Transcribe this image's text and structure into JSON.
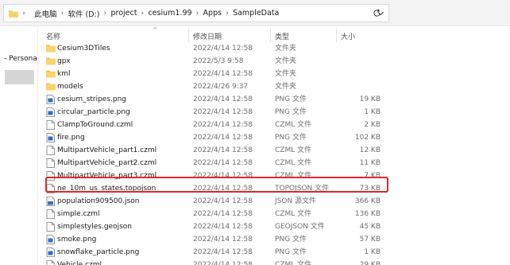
{
  "address": {
    "crumbs": [
      "此电脑",
      "软件 (D:)",
      "project",
      "cesium1.99",
      "Apps",
      "SampleData"
    ]
  },
  "left_pane": {
    "label": "- Persona"
  },
  "columns": {
    "name": "名称",
    "date": "修改日期",
    "type": "类型",
    "size": "大小"
  },
  "rows": [
    {
      "name": "Cesium3DTiles",
      "date": "2022/4/14 12:58",
      "type": "文件夹",
      "size": "",
      "icon": "folder-icon"
    },
    {
      "name": "gpx",
      "date": "2022/5/3 9:58",
      "type": "文件夹",
      "size": "",
      "icon": "folder-icon"
    },
    {
      "name": "kml",
      "date": "2022/4/14 12:58",
      "type": "文件夹",
      "size": "",
      "icon": "folder-icon"
    },
    {
      "name": "models",
      "date": "2022/4/26 9:37",
      "type": "文件夹",
      "size": "",
      "icon": "folder-icon"
    },
    {
      "name": "cesium_stripes.png",
      "date": "2022/4/14 12:58",
      "type": "PNG 文件",
      "size": "19 KB",
      "icon": "image-file-icon"
    },
    {
      "name": "circular_particle.png",
      "date": "2022/4/14 12:58",
      "type": "PNG 文件",
      "size": "1 KB",
      "icon": "image-file-icon"
    },
    {
      "name": "ClampToGround.czml",
      "date": "2022/4/14 12:58",
      "type": "CZML 文件",
      "size": "2 KB",
      "icon": "document-file-icon"
    },
    {
      "name": "fire.png",
      "date": "2022/4/14 12:58",
      "type": "PNG 文件",
      "size": "102 KB",
      "icon": "image-file-icon"
    },
    {
      "name": "MultipartVehicle_part1.czml",
      "date": "2022/4/14 12:58",
      "type": "CZML 文件",
      "size": "12 KB",
      "icon": "document-file-icon"
    },
    {
      "name": "MultipartVehicle_part2.czml",
      "date": "2022/4/14 12:58",
      "type": "CZML 文件",
      "size": "11 KB",
      "icon": "document-file-icon"
    },
    {
      "name": "MultipartVehicle_part3.czml",
      "date": "2022/4/14 12:58",
      "type": "CZML 文件",
      "size": "7 KB",
      "icon": "document-file-icon"
    },
    {
      "name": "ne_10m_us_states.topojson",
      "date": "2022/4/14 12:58",
      "type": "TOPOJSON 文件",
      "size": "73 KB",
      "icon": "document-file-icon"
    },
    {
      "name": "population909500.json",
      "date": "2022/4/14 12:58",
      "type": "JSON 源文件",
      "size": "366 KB",
      "icon": "json-file-icon"
    },
    {
      "name": "simple.czml",
      "date": "2022/4/14 12:58",
      "type": "CZML 文件",
      "size": "136 KB",
      "icon": "document-file-icon"
    },
    {
      "name": "simplestyles.geojson",
      "date": "2022/4/14 12:58",
      "type": "GEOJSON 文件",
      "size": "45 KB",
      "icon": "document-file-icon"
    },
    {
      "name": "smoke.png",
      "date": "2022/4/14 12:58",
      "type": "PNG 文件",
      "size": "57 KB",
      "icon": "image-file-icon"
    },
    {
      "name": "snowflake_particle.png",
      "date": "2022/4/14 12:58",
      "type": "PNG 文件",
      "size": "1 KB",
      "icon": "image-file-icon"
    },
    {
      "name": "Vehicle.czml",
      "date": "2022/4/14 12:58",
      "type": "CZML 文件",
      "size": "29 KB",
      "icon": "document-file-icon"
    }
  ],
  "colors": {
    "highlight_border": "#e0262b",
    "folder": "#f2c24f",
    "image_icon": "#2f6fc4"
  }
}
